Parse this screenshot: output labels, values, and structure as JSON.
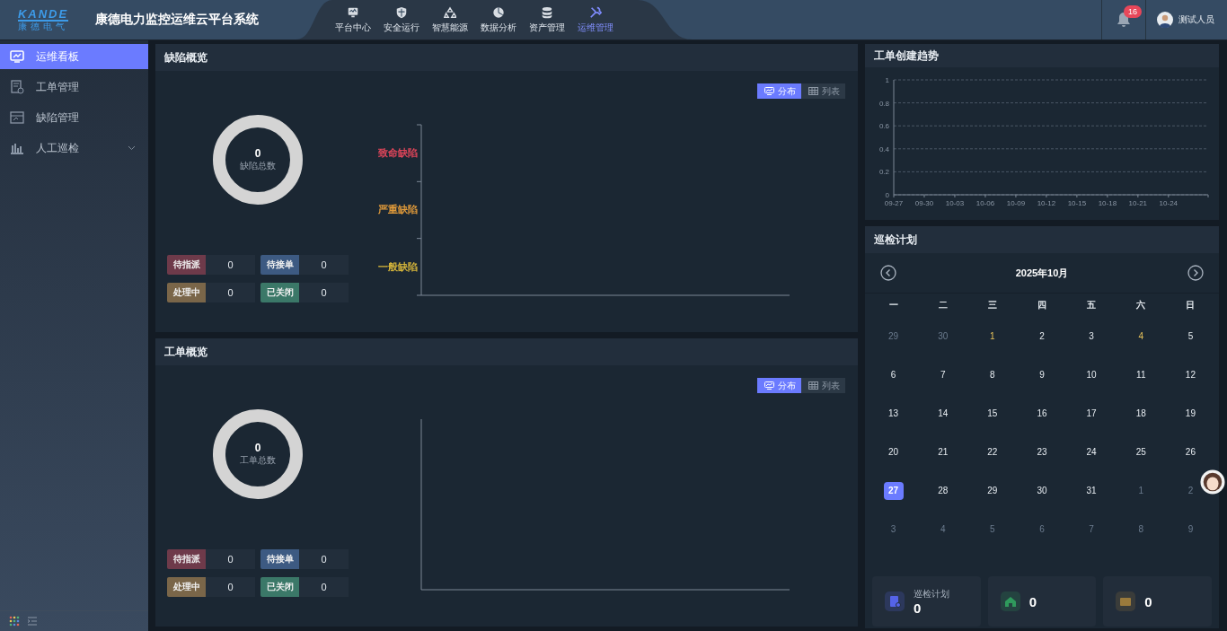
{
  "header": {
    "logo_text": "KANDE",
    "logo_subtitle": "康德电气",
    "title": "康德电力监控运维云平台系统",
    "nav": [
      {
        "label": "平台中心",
        "selected": false
      },
      {
        "label": "安全运行",
        "selected": false
      },
      {
        "label": "智慧能源",
        "selected": false
      },
      {
        "label": "数据分析",
        "selected": false
      },
      {
        "label": "资产管理",
        "selected": false
      },
      {
        "label": "运维管理",
        "selected": true
      }
    ],
    "notification_count": "16",
    "user": "测试人员"
  },
  "sidebar": {
    "items": [
      {
        "label": "运维看板",
        "selected": true,
        "kind": "link"
      },
      {
        "label": "工单管理",
        "selected": false,
        "kind": "link"
      },
      {
        "label": "缺陷管理",
        "selected": false,
        "kind": "link"
      },
      {
        "label": "人工巡检",
        "selected": false,
        "kind": "group"
      }
    ]
  },
  "defect_overview": {
    "title": "缺陷概览",
    "toggle": [
      {
        "label": "分布",
        "selected": true
      },
      {
        "label": "列表",
        "selected": false
      }
    ],
    "total": {
      "value": "0",
      "label": "缺陷总数"
    },
    "statuses": [
      {
        "label": "待指派",
        "color": "#6e3a4a",
        "value": "0"
      },
      {
        "label": "待接单",
        "color": "#3d5a82",
        "value": "0"
      },
      {
        "label": "处理中",
        "color": "#7a6649",
        "value": "0"
      },
      {
        "label": "已关闭",
        "color": "#3b7868",
        "value": "0"
      }
    ],
    "levels": [
      {
        "label": "致命缺陷",
        "color": "#e0455a"
      },
      {
        "label": "严重缺陷",
        "color": "#e09a3a"
      },
      {
        "label": "一般缺陷",
        "color": "#d4b43a"
      }
    ]
  },
  "work_order_overview": {
    "title": "工单概览",
    "toggle": [
      {
        "label": "分布",
        "selected": true
      },
      {
        "label": "列表",
        "selected": false
      }
    ],
    "total": {
      "value": "0",
      "label": "工单总数"
    },
    "statuses": [
      {
        "label": "待指派",
        "color": "#6e3a4a",
        "value": "0"
      },
      {
        "label": "待接单",
        "color": "#3d5a82",
        "value": "0"
      },
      {
        "label": "处理中",
        "color": "#7a6649",
        "value": "0"
      },
      {
        "label": "已关闭",
        "color": "#3b7868",
        "value": "0"
      }
    ]
  },
  "trend": {
    "title": "工单创建趋势",
    "chart_data": {
      "type": "line",
      "categories": [
        "09-27",
        "09-30",
        "10-03",
        "10-06",
        "10-09",
        "10-12",
        "10-15",
        "10-18",
        "10-21",
        "10-24"
      ],
      "grid": true,
      "ylim": [
        0,
        1
      ],
      "yticks": [
        0,
        0.2,
        0.4,
        0.6,
        0.8,
        1
      ]
    }
  },
  "patrol_plan": {
    "title": "巡检计划",
    "month": "2025年10月",
    "weekdays": [
      "一",
      "二",
      "三",
      "四",
      "五",
      "六",
      "日"
    ],
    "weeks": [
      [
        {
          "label": "29",
          "kind": "other",
          "selected": false
        },
        {
          "label": "30",
          "kind": "other",
          "selected": false
        },
        {
          "label": "1",
          "kind": "marked",
          "selected": false
        },
        {
          "label": "2",
          "kind": "current",
          "selected": false
        },
        {
          "label": "3",
          "kind": "current",
          "selected": false
        },
        {
          "label": "4",
          "kind": "marked",
          "selected": false
        },
        {
          "label": "5",
          "kind": "current",
          "selected": false
        }
      ],
      [
        {
          "label": "6",
          "kind": "current",
          "selected": false
        },
        {
          "label": "7",
          "kind": "current",
          "selected": false
        },
        {
          "label": "8",
          "kind": "current",
          "selected": false
        },
        {
          "label": "9",
          "kind": "current",
          "selected": false
        },
        {
          "label": "10",
          "kind": "current",
          "selected": false
        },
        {
          "label": "11",
          "kind": "current",
          "selected": false
        },
        {
          "label": "12",
          "kind": "current",
          "selected": false
        }
      ],
      [
        {
          "label": "13",
          "kind": "current",
          "selected": false
        },
        {
          "label": "14",
          "kind": "current",
          "selected": false
        },
        {
          "label": "15",
          "kind": "current",
          "selected": false
        },
        {
          "label": "16",
          "kind": "current",
          "selected": false
        },
        {
          "label": "17",
          "kind": "current",
          "selected": false
        },
        {
          "label": "18",
          "kind": "current",
          "selected": false
        },
        {
          "label": "19",
          "kind": "current",
          "selected": false
        }
      ],
      [
        {
          "label": "20",
          "kind": "current",
          "selected": false
        },
        {
          "label": "21",
          "kind": "current",
          "selected": false
        },
        {
          "label": "22",
          "kind": "current",
          "selected": false
        },
        {
          "label": "23",
          "kind": "current",
          "selected": false
        },
        {
          "label": "24",
          "kind": "current",
          "selected": false
        },
        {
          "label": "25",
          "kind": "current",
          "selected": false
        },
        {
          "label": "26",
          "kind": "current",
          "selected": false
        }
      ],
      [
        {
          "label": "27",
          "kind": "current",
          "selected": true
        },
        {
          "label": "28",
          "kind": "current",
          "selected": false
        },
        {
          "label": "29",
          "kind": "current",
          "selected": false
        },
        {
          "label": "30",
          "kind": "current",
          "selected": false
        },
        {
          "label": "31",
          "kind": "current",
          "selected": false
        },
        {
          "label": "1",
          "kind": "other",
          "selected": false
        },
        {
          "label": "2",
          "kind": "other",
          "selected": false
        }
      ],
      [
        {
          "label": "3",
          "kind": "other",
          "selected": false
        },
        {
          "label": "4",
          "kind": "other",
          "selected": false
        },
        {
          "label": "5",
          "kind": "other",
          "selected": false
        },
        {
          "label": "6",
          "kind": "other",
          "selected": false
        },
        {
          "label": "7",
          "kind": "other",
          "selected": false
        },
        {
          "label": "8",
          "kind": "other",
          "selected": false
        },
        {
          "label": "9",
          "kind": "other",
          "selected": false
        }
      ]
    ],
    "stats": [
      {
        "label": "巡检计划",
        "value": "0",
        "color": "#5563e8"
      },
      {
        "value": "0",
        "color": "#2f9a5c"
      },
      {
        "value": "0",
        "color": "#9a7a3c"
      }
    ]
  }
}
